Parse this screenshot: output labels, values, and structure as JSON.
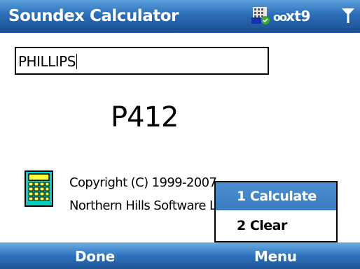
{
  "titlebar": {
    "title": "Soundex Calculator",
    "input_mode": "xt9",
    "icons": [
      "signal-bars-icon",
      "antenna-icon"
    ]
  },
  "form": {
    "name_value": "PHILLIPS",
    "result": "P412"
  },
  "about": {
    "icon": "calculator-icon",
    "copyright": "Copyright (C) 1999-2007",
    "company": "Northern Hills Software L"
  },
  "menu_popup": {
    "items": [
      {
        "label": "1 Calculate",
        "selected": true
      },
      {
        "label": "2 Clear",
        "selected": false
      }
    ],
    "highlight_color": "#3a7cc2"
  },
  "softkeys": {
    "left": "Done",
    "right": "Menu"
  },
  "colors": {
    "title_bar": "#2a6db8",
    "soft_bar": "#2f73bd"
  }
}
